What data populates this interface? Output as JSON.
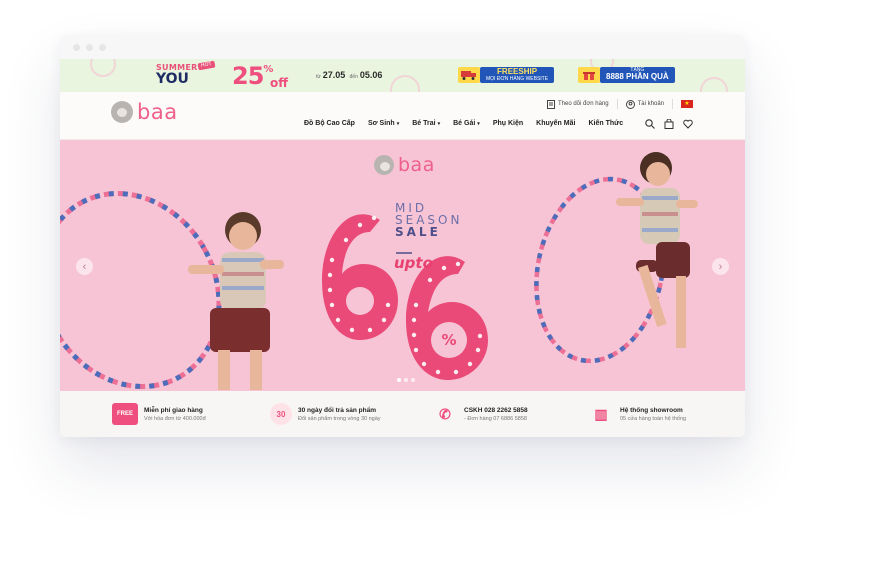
{
  "promo": {
    "summer_label": "SUMMER",
    "you_label": "YOU",
    "hot_tag": "HOT",
    "discount_number": "25",
    "discount_percent": "%",
    "discount_off": "off",
    "date_from_prefix": "từ",
    "date_from": "27.05",
    "date_to_prefix": "đến",
    "date_to": "05.06",
    "freeship_title": "FREESHIP",
    "freeship_sub": "MỌI ĐƠN HÀNG WEBSITE",
    "gift_top": "TẶNG",
    "gift_main": "8888 PHẦN QUÀ"
  },
  "header": {
    "logo_text": "baa",
    "track_order": "Theo dõi đơn hàng",
    "account": "Tài khoản",
    "flag_star": "★",
    "nav": [
      {
        "label": "Đồ Bộ Cao Cấp",
        "caret": ""
      },
      {
        "label": "Sơ Sinh",
        "caret": "▾"
      },
      {
        "label": "Bé Trai",
        "caret": "▾"
      },
      {
        "label": "Bé Gái",
        "caret": "▾"
      },
      {
        "label": "Phụ Kiện",
        "caret": ""
      },
      {
        "label": "Khuyến Mãi",
        "caret": ""
      },
      {
        "label": "Kiến Thức",
        "caret": ""
      }
    ]
  },
  "hero": {
    "logo_text": "baa",
    "line1": "MID",
    "line2": "SEASON",
    "line3": "SALE",
    "upto": "upto",
    "big_digit_1": "6",
    "big_digit_2": "6",
    "percent": "%",
    "prev_arrow": "‹",
    "next_arrow": "›"
  },
  "features": [
    {
      "icon_text": "FREE",
      "title": "Miễn phí giao hàng",
      "sub": "Với hóa đơn từ 400.000đ"
    },
    {
      "icon_text": "30",
      "title": "30 ngày đổi trả sản phẩm",
      "sub": "Đổi sản phẩm trong vòng 30 ngày"
    },
    {
      "icon_text": "✆",
      "title": "CSKH 028 2262 5858",
      "sub": "- Đơn hàng 07 6886 5858"
    },
    {
      "icon_text": "▥",
      "title": "Hệ thống showroom",
      "sub": "05 cửa hàng toàn hệ thống"
    }
  ],
  "colors": {
    "brand_pink": "#ef5f8c",
    "hero_bg": "#f7c4d6",
    "promo_bg": "#e9f5de",
    "navy": "#2156b8"
  }
}
